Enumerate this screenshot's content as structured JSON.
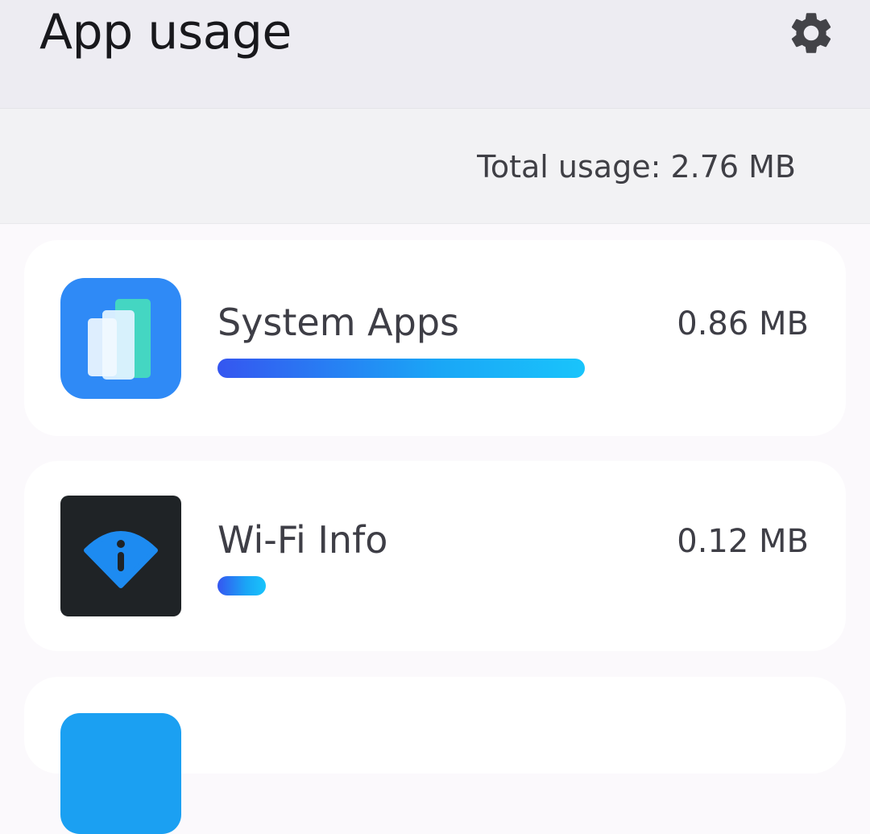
{
  "header": {
    "title": "App usage",
    "settings_icon": "gear-icon"
  },
  "summary": {
    "total_usage": "Total usage: 2.76 MB"
  },
  "apps": [
    {
      "name": "System Apps",
      "size": "0.86 MB",
      "usage_fraction": 0.53,
      "icon": "system-apps-icon"
    },
    {
      "name": "Wi-Fi Info",
      "size": "0.12 MB",
      "usage_fraction": 0.07,
      "icon": "wifi-info-icon"
    },
    {
      "name": "",
      "size": "",
      "icon": "app-icon"
    }
  ],
  "colors": {
    "header_bg": "#edecf2",
    "bar_start": "#3556f0",
    "bar_end": "#19c4fb",
    "system_icon_bg": "#2f8af6",
    "wifi_icon_bg": "#1f2326",
    "wifi_accent": "#1d8bf1"
  }
}
